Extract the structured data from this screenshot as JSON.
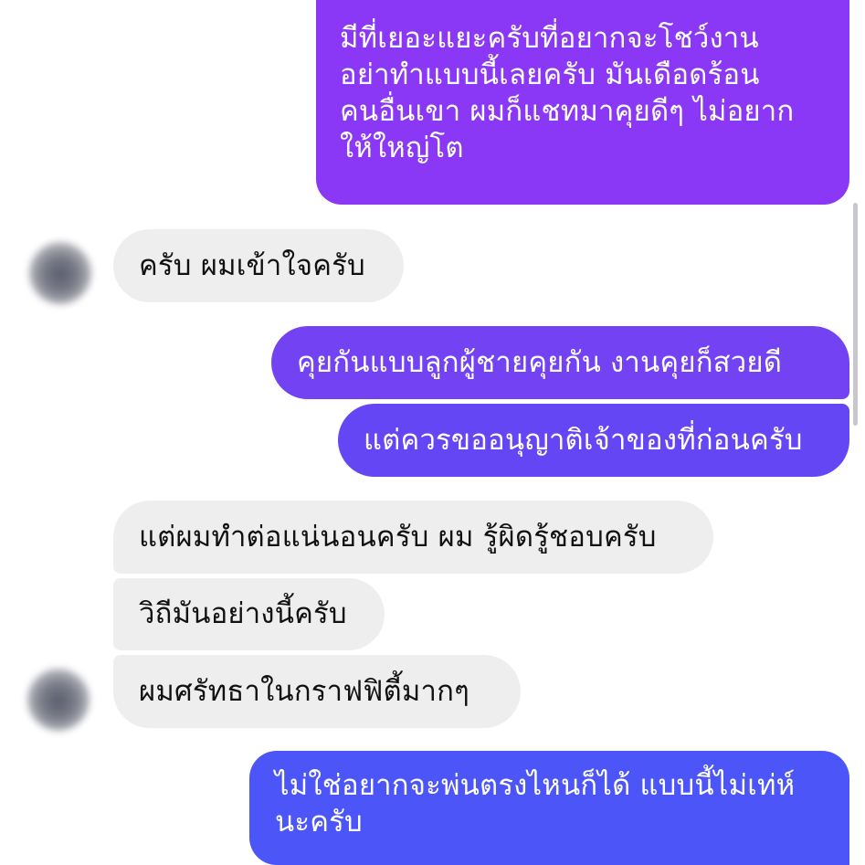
{
  "messages": [
    {
      "id": "m1",
      "side": "outgoing",
      "text": "มีที่เยอะแยะครับที่อยากจะโชว์งาน\nอย่าทำแบบนี้เลยครับ มันเดือดร้อน\nคนอื่นเขา ผมก็แชทมาคุยดีๆ ไม่อยาก\nให้ใหญ่โต"
    },
    {
      "id": "m2",
      "side": "incoming",
      "text": "ครับ ผมเข้าใจครับ"
    },
    {
      "id": "m3",
      "side": "outgoing",
      "text": "คุยกันแบบลูกผู้ชายคุยกัน งานคุยก็สวยดี"
    },
    {
      "id": "m4",
      "side": "outgoing",
      "text": "แต่ควรขออนุญาติเจ้าของที่ก่อนครับ"
    },
    {
      "id": "m5",
      "side": "incoming",
      "text": "แต่ผมทำต่อแน่นอนครับ ผม รู้ผิดรู้ชอบครับ"
    },
    {
      "id": "m6",
      "side": "incoming",
      "text": "วิถีมันอย่างนี้ครับ"
    },
    {
      "id": "m7",
      "side": "incoming",
      "text": "ผมศรัทธาในกราฟฟิตี้มากๆ"
    },
    {
      "id": "m8",
      "side": "outgoing",
      "text": "ไม่ใช่อยากจะพ่นตรงไหนก็ได้ แบบนี้ไม่เท่ห์\nนะครับ"
    }
  ],
  "colors": {
    "outgoing_top": "#8a38f5",
    "outgoing_mid": "#6c43f4",
    "outgoing_bottom": "#4c55f7",
    "incoming_bg": "#eeeeef"
  }
}
